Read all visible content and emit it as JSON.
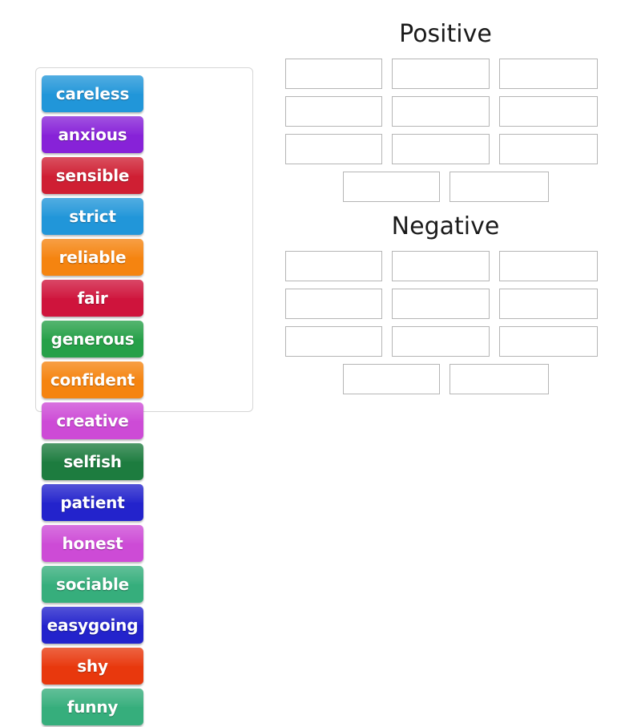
{
  "word_bank": {
    "name": "word-bank",
    "tiles": [
      {
        "label": "careless",
        "color": "#2196d9"
      },
      {
        "label": "anxious",
        "color": "#8722d8"
      },
      {
        "label": "sensible",
        "color": "#cf1f33"
      },
      {
        "label": "strict",
        "color": "#2196d9"
      },
      {
        "label": "reliable",
        "color": "#f58410"
      },
      {
        "label": "fair",
        "color": "#cf143c"
      },
      {
        "label": "generous",
        "color": "#26a048"
      },
      {
        "label": "confident",
        "color": "#f58410"
      },
      {
        "label": "creative",
        "color": "#cd4bd6"
      },
      {
        "label": "selfish",
        "color": "#1d7c3f"
      },
      {
        "label": "patient",
        "color": "#2323cc"
      },
      {
        "label": "honest",
        "color": "#cd4bd6"
      },
      {
        "label": "sociable",
        "color": "#36ae7c"
      },
      {
        "label": "easygoing",
        "color": "#2323cc"
      },
      {
        "label": "shy",
        "color": "#e8380d"
      },
      {
        "label": "funny",
        "color": "#36ae7c"
      }
    ]
  },
  "drop_area": {
    "zones": [
      {
        "title": "Positive",
        "rows": [
          {
            "slots": 3,
            "centered": false
          },
          {
            "slots": 3,
            "centered": false
          },
          {
            "slots": 3,
            "centered": false
          },
          {
            "slots": 2,
            "centered": true
          }
        ]
      },
      {
        "title": "Negative",
        "rows": [
          {
            "slots": 3,
            "centered": false
          },
          {
            "slots": 3,
            "centered": false
          },
          {
            "slots": 3,
            "centered": false
          },
          {
            "slots": 2,
            "centered": true
          }
        ]
      }
    ]
  }
}
